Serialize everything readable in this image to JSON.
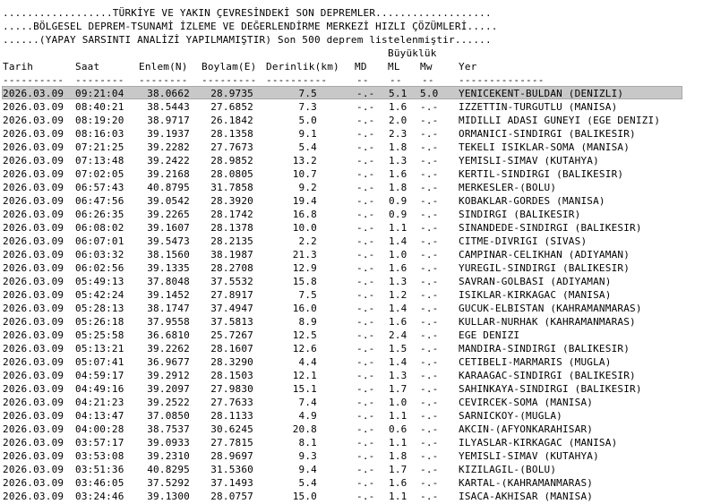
{
  "header": {
    "line1": "..................TÜRKİYE VE YAKIN ÇEVRESİNDEKİ SON DEPREMLER...................",
    "line2": ".....BÖLGESEL DEPREM-TSUNAMİ İZLEME VE DEĞERLENDİRME MERKEZİ HIZLI ÇÖZÜMLERİ.....",
    "line3": "......(YAPAY SARSINTI ANALİZİ YAPILMAMIŞTIR) Son 500 deprem listelenmiştir......"
  },
  "columns": {
    "group": "Büyüklük",
    "tarih": "Tarih",
    "saat": "Saat",
    "enlem": "Enlem(N)",
    "boylam": "Boylam(E)",
    "derinlik": "Derinlik(km)",
    "md": "MD",
    "ml": "ML",
    "mw": "Mw",
    "yer": "Yer"
  },
  "dashes": {
    "tarih": "----------",
    "saat": "--------",
    "enlem": "--------",
    "boylam": "---------",
    "derinlik": "----------",
    "md": "--",
    "ml": "--",
    "mw": "--",
    "yer": "--------------"
  },
  "selected_row": 0,
  "rows": [
    {
      "tarih": "2026.03.09",
      "saat": "09:21:04",
      "enlem": "38.0662",
      "boylam": "28.9735",
      "derinlik": "7.5",
      "md": "-.-",
      "ml": "5.1",
      "mw": "5.0",
      "yer": "YENICEKENT-BULDAN (DENIZLI)"
    },
    {
      "tarih": "2026.03.09",
      "saat": "08:40:21",
      "enlem": "38.5443",
      "boylam": "27.6852",
      "derinlik": "7.3",
      "md": "-.-",
      "ml": "1.6",
      "mw": "-.-",
      "yer": "IZZETTIN-TURGUTLU (MANISA)"
    },
    {
      "tarih": "2026.03.09",
      "saat": "08:19:20",
      "enlem": "38.9717",
      "boylam": "26.1842",
      "derinlik": "5.0",
      "md": "-.-",
      "ml": "2.0",
      "mw": "-.-",
      "yer": "MIDILLI ADASI GUNEYI (EGE DENIZI)"
    },
    {
      "tarih": "2026.03.09",
      "saat": "08:16:03",
      "enlem": "39.1937",
      "boylam": "28.1358",
      "derinlik": "9.1",
      "md": "-.-",
      "ml": "2.3",
      "mw": "-.-",
      "yer": "ORMANICI-SINDIRGI (BALIKESIR)"
    },
    {
      "tarih": "2026.03.09",
      "saat": "07:21:25",
      "enlem": "39.2282",
      "boylam": "27.7673",
      "derinlik": "5.4",
      "md": "-.-",
      "ml": "1.8",
      "mw": "-.-",
      "yer": "TEKELI ISIKLAR-SOMA (MANISA)"
    },
    {
      "tarih": "2026.03.09",
      "saat": "07:13:48",
      "enlem": "39.2422",
      "boylam": "28.9852",
      "derinlik": "13.2",
      "md": "-.-",
      "ml": "1.3",
      "mw": "-.-",
      "yer": "YEMISLI-SIMAV (KUTAHYA)"
    },
    {
      "tarih": "2026.03.09",
      "saat": "07:02:05",
      "enlem": "39.2168",
      "boylam": "28.0805",
      "derinlik": "10.7",
      "md": "-.-",
      "ml": "1.6",
      "mw": "-.-",
      "yer": "KERTIL-SINDIRGI (BALIKESIR)"
    },
    {
      "tarih": "2026.03.09",
      "saat": "06:57:43",
      "enlem": "40.8795",
      "boylam": "31.7858",
      "derinlik": "9.2",
      "md": "-.-",
      "ml": "1.8",
      "mw": "-.-",
      "yer": "MERKESLER-(BOLU)"
    },
    {
      "tarih": "2026.03.09",
      "saat": "06:47:56",
      "enlem": "39.0542",
      "boylam": "28.3920",
      "derinlik": "19.4",
      "md": "-.-",
      "ml": "0.9",
      "mw": "-.-",
      "yer": "KOBAKLAR-GORDES (MANISA)"
    },
    {
      "tarih": "2026.03.09",
      "saat": "06:26:35",
      "enlem": "39.2265",
      "boylam": "28.1742",
      "derinlik": "16.8",
      "md": "-.-",
      "ml": "0.9",
      "mw": "-.-",
      "yer": "SINDIRGI (BALIKESIR)"
    },
    {
      "tarih": "2026.03.09",
      "saat": "06:08:02",
      "enlem": "39.1607",
      "boylam": "28.1378",
      "derinlik": "10.0",
      "md": "-.-",
      "ml": "1.1",
      "mw": "-.-",
      "yer": "SINANDEDE-SINDIRGI (BALIKESIR)"
    },
    {
      "tarih": "2026.03.09",
      "saat": "06:07:01",
      "enlem": "39.5473",
      "boylam": "28.2135",
      "derinlik": "2.2",
      "md": "-.-",
      "ml": "1.4",
      "mw": "-.-",
      "yer": "CITME-DIVRIGI (SIVAS)"
    },
    {
      "tarih": "2026.03.09",
      "saat": "06:03:32",
      "enlem": "38.1560",
      "boylam": "38.1987",
      "derinlik": "21.3",
      "md": "-.-",
      "ml": "1.0",
      "mw": "-.-",
      "yer": "CAMPINAR-CELIKHAN (ADIYAMAN)"
    },
    {
      "tarih": "2026.03.09",
      "saat": "06:02:56",
      "enlem": "39.1335",
      "boylam": "28.2708",
      "derinlik": "12.9",
      "md": "-.-",
      "ml": "1.6",
      "mw": "-.-",
      "yer": "YUREGIL-SINDIRGI (BALIKESIR)"
    },
    {
      "tarih": "2026.03.09",
      "saat": "05:49:13",
      "enlem": "37.8048",
      "boylam": "37.5532",
      "derinlik": "15.8",
      "md": "-.-",
      "ml": "1.3",
      "mw": "-.-",
      "yer": "SAVRAN-GOLBASI (ADIYAMAN)"
    },
    {
      "tarih": "2026.03.09",
      "saat": "05:42:24",
      "enlem": "39.1452",
      "boylam": "27.8917",
      "derinlik": "7.5",
      "md": "-.-",
      "ml": "1.2",
      "mw": "-.-",
      "yer": "ISIKLAR-KIRKAGAC (MANISA)"
    },
    {
      "tarih": "2026.03.09",
      "saat": "05:28:13",
      "enlem": "38.1747",
      "boylam": "37.4947",
      "derinlik": "16.0",
      "md": "-.-",
      "ml": "1.4",
      "mw": "-.-",
      "yer": "GUCUK-ELBISTAN (KAHRAMANMARAS)"
    },
    {
      "tarih": "2026.03.09",
      "saat": "05:26:18",
      "enlem": "37.9558",
      "boylam": "37.5813",
      "derinlik": "8.9",
      "md": "-.-",
      "ml": "1.6",
      "mw": "-.-",
      "yer": "KULLAR-NURHAK (KAHRAMANMARAS)"
    },
    {
      "tarih": "2026.03.09",
      "saat": "05:25:58",
      "enlem": "36.6810",
      "boylam": "25.7267",
      "derinlik": "12.5",
      "md": "-.-",
      "ml": "2.4",
      "mw": "-.-",
      "yer": "EGE DENIZI"
    },
    {
      "tarih": "2026.03.09",
      "saat": "05:13:21",
      "enlem": "39.2262",
      "boylam": "28.1607",
      "derinlik": "12.6",
      "md": "-.-",
      "ml": "1.5",
      "mw": "-.-",
      "yer": "MANDIRA-SINDIRGI (BALIKESIR)"
    },
    {
      "tarih": "2026.03.09",
      "saat": "05:07:41",
      "enlem": "36.9677",
      "boylam": "28.3290",
      "derinlik": "4.4",
      "md": "-.-",
      "ml": "1.4",
      "mw": "-.-",
      "yer": "CETIBELI-MARMARIS (MUGLA)"
    },
    {
      "tarih": "2026.03.09",
      "saat": "04:59:17",
      "enlem": "39.2912",
      "boylam": "28.1503",
      "derinlik": "12.1",
      "md": "-.-",
      "ml": "1.3",
      "mw": "-.-",
      "yer": "KARAAGAC-SINDIRGI (BALIKESIR)"
    },
    {
      "tarih": "2026.03.09",
      "saat": "04:49:16",
      "enlem": "39.2097",
      "boylam": "27.9830",
      "derinlik": "15.1",
      "md": "-.-",
      "ml": "1.7",
      "mw": "-.-",
      "yer": "SAHINKAYA-SINDIRGI (BALIKESIR)"
    },
    {
      "tarih": "2026.03.09",
      "saat": "04:21:23",
      "enlem": "39.2522",
      "boylam": "27.7633",
      "derinlik": "7.4",
      "md": "-.-",
      "ml": "1.0",
      "mw": "-.-",
      "yer": "CEVIRCEK-SOMA (MANISA)"
    },
    {
      "tarih": "2026.03.09",
      "saat": "04:13:47",
      "enlem": "37.0850",
      "boylam": "28.1133",
      "derinlik": "4.9",
      "md": "-.-",
      "ml": "1.1",
      "mw": "-.-",
      "yer": "SARNICKOY-(MUGLA)"
    },
    {
      "tarih": "2026.03.09",
      "saat": "04:00:28",
      "enlem": "38.7537",
      "boylam": "30.6245",
      "derinlik": "20.8",
      "md": "-.-",
      "ml": "0.6",
      "mw": "-.-",
      "yer": "AKCIN-(AFYONKARAHISAR)"
    },
    {
      "tarih": "2026.03.09",
      "saat": "03:57:17",
      "enlem": "39.0933",
      "boylam": "27.7815",
      "derinlik": "8.1",
      "md": "-.-",
      "ml": "1.1",
      "mw": "-.-",
      "yer": "ILYASLAR-KIRKAGAC (MANISA)"
    },
    {
      "tarih": "2026.03.09",
      "saat": "03:53:08",
      "enlem": "39.2310",
      "boylam": "28.9697",
      "derinlik": "9.3",
      "md": "-.-",
      "ml": "1.8",
      "mw": "-.-",
      "yer": "YEMISLI-SIMAV (KUTAHYA)"
    },
    {
      "tarih": "2026.03.09",
      "saat": "03:51:36",
      "enlem": "40.8295",
      "boylam": "31.5360",
      "derinlik": "9.4",
      "md": "-.-",
      "ml": "1.7",
      "mw": "-.-",
      "yer": "KIZILAGIL-(BOLU)"
    },
    {
      "tarih": "2026.03.09",
      "saat": "03:46:05",
      "enlem": "37.5292",
      "boylam": "37.1493",
      "derinlik": "5.4",
      "md": "-.-",
      "ml": "1.6",
      "mw": "-.-",
      "yer": "KARTAL-(KAHRAMANMARAS)"
    },
    {
      "tarih": "2026.03.09",
      "saat": "03:24:46",
      "enlem": "39.1300",
      "boylam": "28.0757",
      "derinlik": "15.0",
      "md": "-.-",
      "ml": "1.1",
      "mw": "-.-",
      "yer": "ISACA-AKHISAR (MANISA)"
    }
  ]
}
